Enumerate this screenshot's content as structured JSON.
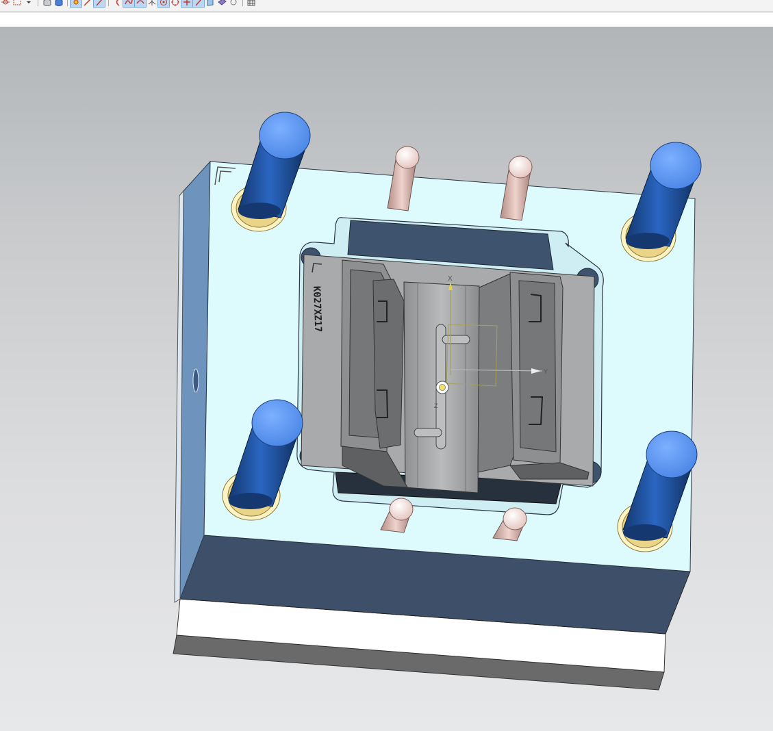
{
  "toolbar": {
    "icons": [
      "snap-point-icon",
      "selection-box-icon",
      "dropdown-arrow-icon",
      "shaded-icon",
      "solid-block-icon",
      "point-icon",
      "line-icon",
      "arrow-icon",
      "arc-icon",
      "spline-icon",
      "curve-icon",
      "intersection-icon",
      "circle-center-icon",
      "quadrant-icon",
      "cross-icon",
      "pen-icon",
      "face-icon",
      "surface-icon",
      "circle-icon",
      "grid-icon"
    ]
  },
  "viewport": {
    "background_top": "#b2b5b8",
    "background_bottom": "#e7e8ea"
  },
  "model": {
    "engraving": "K027XZ17",
    "wcs_labels": {
      "x": "X",
      "y": "Y",
      "z": "Z"
    },
    "colors": {
      "plate_top": "#ddfbfd",
      "plate_side": "#6e93bd",
      "plate_front": "#3e5069",
      "pillar": "#1f4f9e",
      "pillar_cap": "#5b9af2",
      "pin": "#d9b3ac",
      "insert": "#a8aaab"
    }
  }
}
